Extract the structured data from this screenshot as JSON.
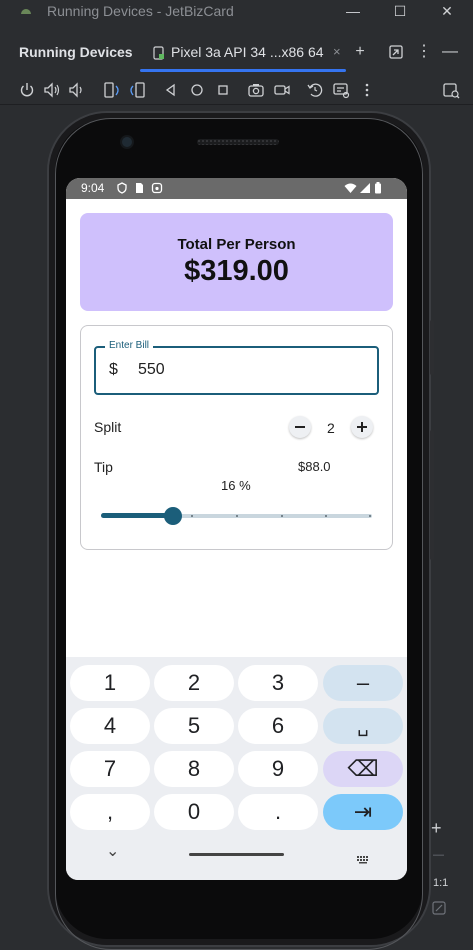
{
  "window": {
    "title": "Running Devices - JetBizCard",
    "minimize_glyph": "—",
    "maximize_glyph": "☐",
    "close_glyph": "✕"
  },
  "tabs": {
    "panel_title": "Running Devices",
    "device_tab_label": "Pixel 3a API 34 ...x86 64",
    "close_glyph": "×",
    "add_glyph": "+",
    "more_glyph": "⋮",
    "minimize_glyph": "—"
  },
  "toolbar": {
    "icons": [
      "power-icon",
      "volume-up-icon",
      "volume-down-icon",
      "rotate-left-icon",
      "rotate-right-icon",
      "back-icon",
      "home-icon",
      "overview-icon",
      "screenshot-icon",
      "screen-record-icon",
      "snapshot-icon",
      "device-settings-icon",
      "more-icon",
      "device-manager-icon"
    ]
  },
  "device": {
    "status_time": "9:04"
  },
  "app": {
    "total_label": "Total Per Person",
    "total_amount": "$319.00",
    "bill_label": "Enter Bill",
    "bill_prefix": "$",
    "bill_value": "550",
    "split_label": "Split",
    "split_count": "2",
    "tip_label": "Tip",
    "tip_amount": "$88.0",
    "tip_percent_text": "16 %",
    "tip_fraction": 0.16,
    "accent_color": "#1b5e7a",
    "card_color": "#cfc0fc"
  },
  "keyboard": {
    "rows": [
      [
        "1",
        "2",
        "3",
        "–"
      ],
      [
        "4",
        "5",
        "6",
        "␣"
      ],
      [
        "7",
        "8",
        "9",
        "⌫"
      ],
      [
        ",",
        "0",
        ".",
        "⇥"
      ]
    ],
    "hide_glyph": "⌄"
  },
  "zoom": {
    "plus_glyph": "+",
    "minus_glyph": "—",
    "ratio_label": "1:1"
  }
}
